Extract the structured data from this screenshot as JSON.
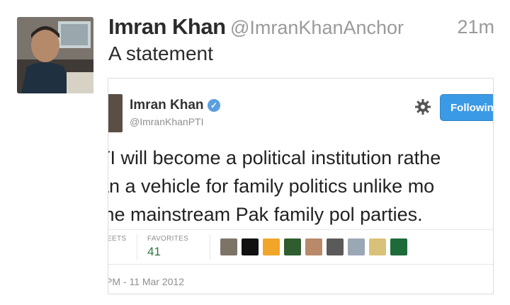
{
  "tweet": {
    "author_name": "Imran Khan",
    "author_handle": "@ImranKhanAnchor",
    "time_ago": "21m",
    "text": "A statement",
    "avatar_icon": "profile-photo-icon"
  },
  "embedded": {
    "author_name": "Imran Khan",
    "author_handle": "@ImranKhanPTI",
    "follow_label": "Followin",
    "verified_icon": "verified-check-icon",
    "gear_icon": "gear-icon",
    "body_lines": [
      "TI will become a political institution rathe",
      "an a vehicle for family politics unlike mo",
      "the mainstream Pak family pol parties."
    ],
    "retweets_label": "EETS",
    "favorites_label": "FAVORITES",
    "favorites_value": "41",
    "date": "PM - 11 Mar 2012",
    "colors": {
      "follow_button": "#3b9ae5",
      "verified": "#5a9fe0"
    }
  }
}
